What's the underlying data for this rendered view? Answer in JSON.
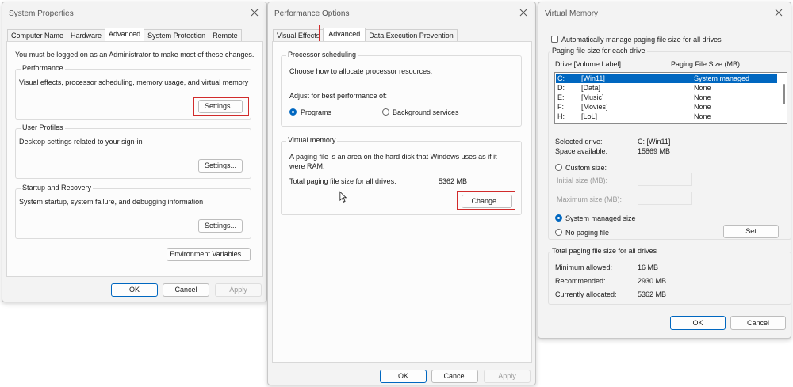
{
  "system_properties": {
    "title": "System Properties",
    "tabs": [
      "Computer Name",
      "Hardware",
      "Advanced",
      "System Protection",
      "Remote"
    ],
    "admin_note": "You must be logged on as an Administrator to make most of these changes.",
    "performance": {
      "heading": "Performance",
      "text": "Visual effects, processor scheduling, memory usage, and virtual memory",
      "button": "Settings..."
    },
    "user_profiles": {
      "heading": "User Profiles",
      "text": "Desktop settings related to your sign-in",
      "button": "Settings..."
    },
    "startup": {
      "heading": "Startup and Recovery",
      "text": "System startup, system failure, and debugging information",
      "button": "Settings..."
    },
    "env_button": "Environment Variables...",
    "ok": "OK",
    "cancel": "Cancel",
    "apply": "Apply"
  },
  "performance_options": {
    "title": "Performance Options",
    "tabs": [
      "Visual Effects",
      "Advanced",
      "Data Execution Prevention"
    ],
    "processor": {
      "heading": "Processor scheduling",
      "text": "Choose how to allocate processor resources.",
      "adjust": "Adjust for best performance of:",
      "programs": "Programs",
      "background": "Background services"
    },
    "virtual_memory": {
      "heading": "Virtual memory",
      "text1": "A paging file is an area on the hard disk that Windows uses as if it",
      "text2": "were RAM.",
      "total_label": "Total paging file size for all drives:",
      "total_value": "5362 MB",
      "change": "Change..."
    },
    "ok": "OK",
    "cancel": "Cancel",
    "apply": "Apply"
  },
  "virtual_memory": {
    "title": "Virtual Memory",
    "auto_manage": "Automatically manage paging file size for all drives",
    "each_drive": "Paging file size for each drive",
    "col_drive": "Drive  [Volume Label]",
    "col_size": "Paging File Size (MB)",
    "drives": [
      {
        "letter": "C:",
        "label": "[Win11]",
        "size": "System managed"
      },
      {
        "letter": "D:",
        "label": "[Data]",
        "size": "None"
      },
      {
        "letter": "E:",
        "label": "[Music]",
        "size": "None"
      },
      {
        "letter": "F:",
        "label": "[Movies]",
        "size": "None"
      },
      {
        "letter": "H:",
        "label": "[LoL]",
        "size": "None"
      }
    ],
    "selected_drive_label": "Selected drive:",
    "selected_drive_value": "C:  [Win11]",
    "space_label": "Space available:",
    "space_value": "15869 MB",
    "custom_size": "Custom size:",
    "initial_size": "Initial size (MB):",
    "maximum_size": "Maximum size (MB):",
    "system_managed": "System managed size",
    "no_paging": "No paging file",
    "set": "Set",
    "total_heading": "Total paging file size for all drives",
    "min_label": "Minimum allowed:",
    "min_value": "16 MB",
    "rec_label": "Recommended:",
    "rec_value": "2930 MB",
    "cur_label": "Currently allocated:",
    "cur_value": "5362 MB",
    "ok": "OK",
    "cancel": "Cancel"
  },
  "colors": {
    "accent": "#0067c0",
    "highlight_box": "#d12b2b"
  },
  "icons": [
    "close-icon",
    "mouse-pointer-icon"
  ]
}
